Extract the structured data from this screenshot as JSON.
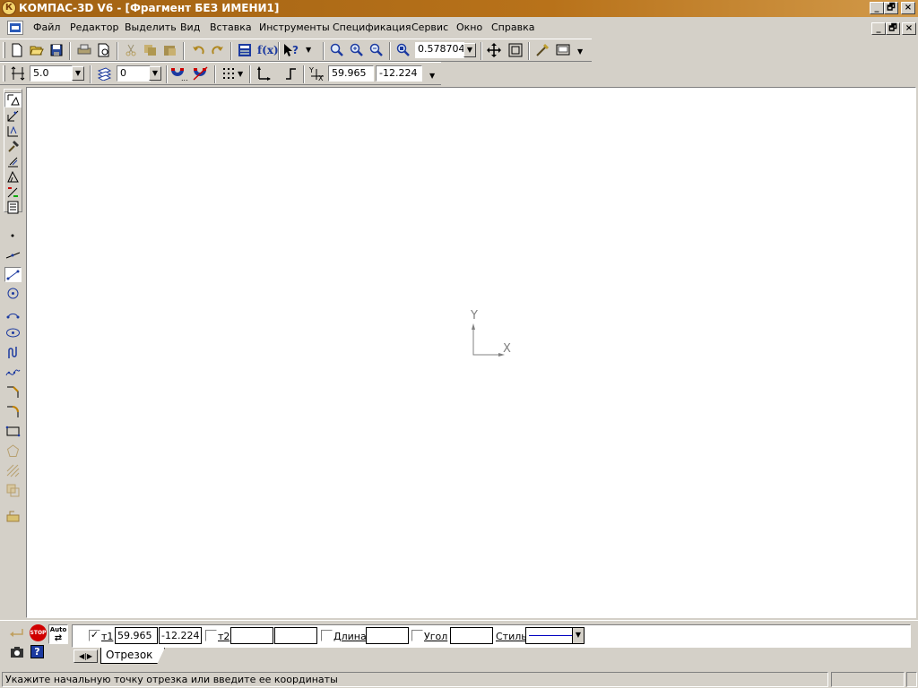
{
  "window": {
    "title": "КОМПАС-3D V6 - [Фрагмент БЕЗ ИМЕНИ1]",
    "logo": "К",
    "controls": [
      "_",
      "🗗",
      "×"
    ]
  },
  "menu": {
    "items": [
      "Файл",
      "Редактор",
      "Выделить",
      "Вид",
      "Вставка",
      "Инструменты",
      "Спецификация",
      "Сервис",
      "Окно",
      "Справка"
    ]
  },
  "toolbar_standard": {
    "zoom_value": "0.578704",
    "icons": [
      "new-document-icon",
      "open-folder-icon",
      "save-icon",
      "print-icon",
      "print-preview-icon",
      "cut-icon",
      "copy-icon",
      "paste-icon",
      "undo-icon",
      "redo-icon",
      "variables-icon",
      "function-icon",
      "help-cursor-icon",
      "zoom-window-icon",
      "zoom-in-icon",
      "zoom-out-icon",
      "zoom-scale-icon",
      "pan-icon",
      "zoom-all-icon",
      "redraw-icon",
      "screen-icon"
    ],
    "fx_label": "f(x)"
  },
  "toolbar_current_state": {
    "step_value": "5.0",
    "layer_value": "0",
    "cursor_x": "59.965",
    "cursor_y": "-12.224",
    "icons": [
      "step-icon",
      "layers-icon",
      "snap-magnet-icon",
      "snap-off-icon",
      "grid-icon",
      "local-cs-icon",
      "ortho-icon",
      "cursor-coords-icon"
    ]
  },
  "left_toolbar": {
    "icons": [
      "geometry-panel-icon",
      "dimensions-panel-icon",
      "designations-panel-icon",
      "editing-panel-icon",
      "parametrization-panel-icon",
      "measure-panel-icon",
      "selection-panel-icon",
      "spec-panel-icon",
      "point-icon",
      "auxiliary-line-icon",
      "segment-icon",
      "circle-icon",
      "arc-icon",
      "ellipse-icon",
      "continuous-input-icon",
      "nurbs-curve-icon",
      "chamfer-icon",
      "fillet-icon",
      "rectangle-icon",
      "polygon-icon",
      "hatch-icon",
      "equidistant-icon",
      "collect-contour-icon"
    ]
  },
  "canvas": {
    "axis_x_label": "X",
    "axis_y_label": "Y"
  },
  "properties": {
    "t1_label": "т1",
    "t1_checked": "✓",
    "t1_x": "59.965",
    "t1_y": "-12.224",
    "t2_label": "т2",
    "t2_x": "",
    "t2_y": "",
    "length_label": "Длина",
    "length_value": "",
    "angle_label": "Угол",
    "angle_value": "",
    "style_label": "Стиль",
    "style_color": "#0000c0",
    "stop_label": "STOP",
    "auto_label": "Auto"
  },
  "tabs": {
    "active": "Отрезок"
  },
  "status": {
    "message": "Укажите начальную точку отрезка или введите ее координаты"
  }
}
